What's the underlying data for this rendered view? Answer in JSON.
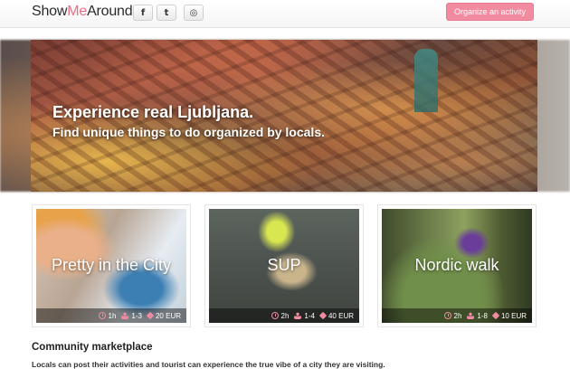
{
  "header": {
    "logo_prefix": "Show",
    "logo_me": "Me",
    "logo_suffix": "Around",
    "social": [
      {
        "label": "f",
        "icon": "facebook-icon"
      },
      {
        "label": "t",
        "icon": "twitter-icon"
      },
      {
        "label": "◎",
        "icon": "instagram-icon"
      }
    ],
    "cta_label": "Organize an activity"
  },
  "hero": {
    "title": "Experience real Ljubljana.",
    "subtitle": "Find unique things to do organized by locals."
  },
  "activities": [
    {
      "title": "Pretty in the City",
      "duration": "1h",
      "people": "1-3",
      "price": "20 EUR"
    },
    {
      "title": "SUP",
      "duration": "2h",
      "people": "1-4",
      "price": "40 EUR"
    },
    {
      "title": "Nordic walk",
      "duration": "2h",
      "people": "1-8",
      "price": "10 EUR"
    }
  ],
  "marketplace": {
    "title": "Community marketplace",
    "description": "Locals can post their activities and tourist can experience the true vibe of a city they are visiting."
  },
  "colors": {
    "accent": "#f28ba0",
    "logo_me": "#e86f86"
  }
}
